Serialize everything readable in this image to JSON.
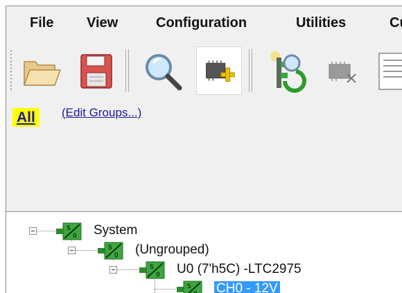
{
  "menu": {
    "items": [
      "File",
      "View",
      "Configuration",
      "Utilities",
      "Cu"
    ]
  },
  "toolbar": {
    "buttons": [
      "open-folder-icon",
      "save-disk-icon",
      "search-icon",
      "add-chip-icon",
      "scan-tree-icon",
      "chip-disabled-icon",
      "document-icon"
    ]
  },
  "groups": {
    "all_label": "All",
    "edit_label": "(Edit Groups...)"
  },
  "tree": {
    "nodes": [
      {
        "label": "System",
        "level": 0
      },
      {
        "label": "(Ungrouped)",
        "level": 1
      },
      {
        "label": "U0 (7'h5C) -LTC2975",
        "level": 2
      },
      {
        "label": "CH0 - 12V",
        "level": 3,
        "selected": true
      }
    ]
  },
  "colors": {
    "selection": "#3399ff",
    "group_highlight": "#ffff00",
    "node_green": "#3ea63e"
  }
}
